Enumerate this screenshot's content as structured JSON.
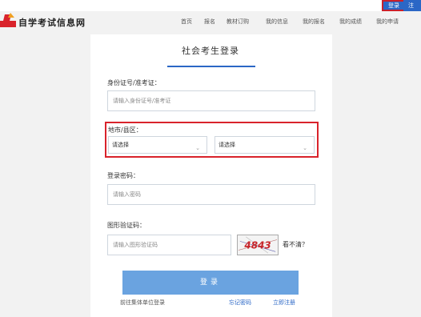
{
  "top": {
    "login_label": "登录",
    "register_label": "注册"
  },
  "header": {
    "logo_text": "自学考试信息网",
    "nav": [
      "首页",
      "报名",
      "教材订购",
      "我的信息",
      "我的报名",
      "我的成绩",
      "我的申请"
    ]
  },
  "login_panel": {
    "title": "社会考生登录",
    "id_label": "身份证号/准考证：",
    "id_placeholder": "请输入身份证号/准考证",
    "region_label": "地市/县区：",
    "city_select": "请选择",
    "county_select": "请选择",
    "password_label": "登录密码：",
    "password_placeholder": "请输入密码",
    "captcha_label": "图形验证码：",
    "captcha_placeholder": "请输入图形验证码",
    "captcha_text": "4843",
    "refresh_text": "看不清？",
    "submit_label": "登录",
    "group_login_link": "前往集体单位登录",
    "forgot_link": "忘记密码",
    "register_link": "立即注册"
  },
  "colors": {
    "accent_blue": "#2b67c6",
    "button_blue": "#6aa3e0",
    "highlight_red": "#d9232b",
    "logo_red": "#d9232b"
  }
}
